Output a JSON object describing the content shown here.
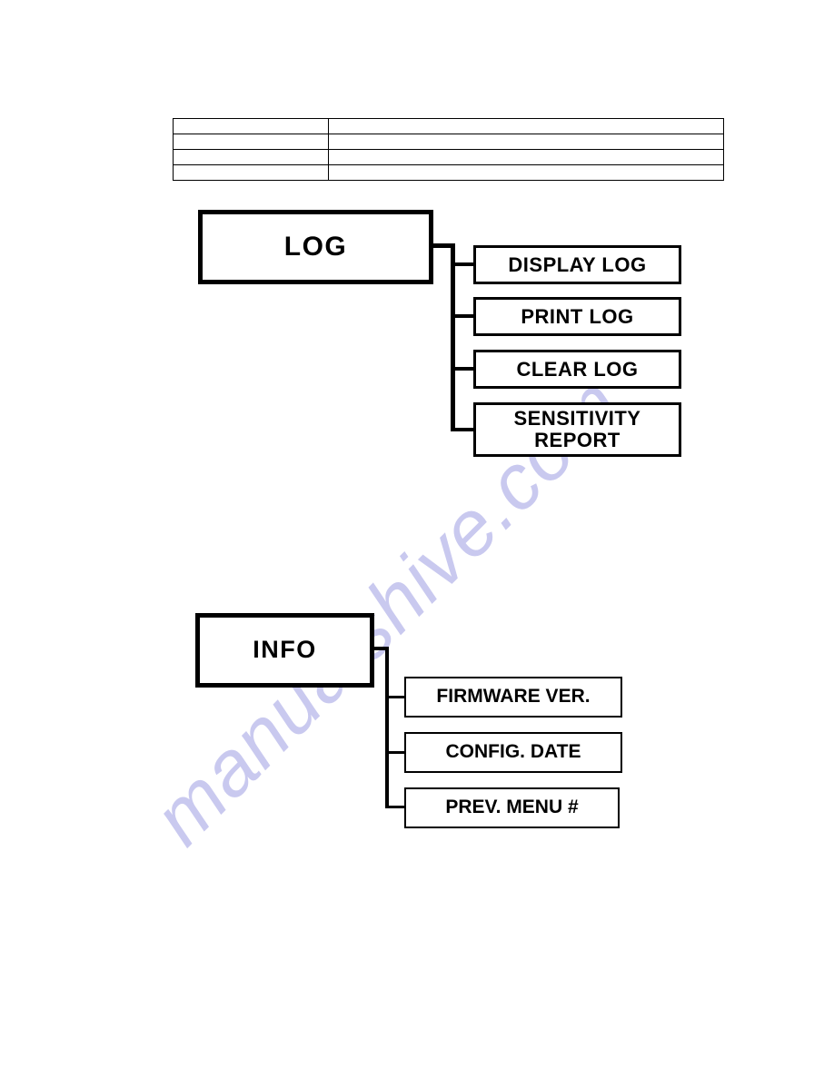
{
  "page": {
    "background": "#ffffff",
    "ink": "#000000",
    "watermark": {
      "text": "manualshive.com",
      "color": "#c9c9ef"
    }
  },
  "spec_table": {
    "columns": [
      "",
      ""
    ],
    "rows": [
      [
        "",
        ""
      ],
      [
        "",
        ""
      ],
      [
        "",
        ""
      ],
      [
        "",
        ""
      ]
    ]
  },
  "diagram": {
    "groups": [
      {
        "id": "log",
        "root": {
          "label": "LOG"
        },
        "children": [
          {
            "label": "DISPLAY LOG"
          },
          {
            "label": "PRINT LOG"
          },
          {
            "label": "CLEAR LOG"
          },
          {
            "label_line1": "SENSITIVITY",
            "label_line2": "REPORT"
          }
        ]
      },
      {
        "id": "info",
        "root": {
          "label": "INFO"
        },
        "children": [
          {
            "label": "FIRMWARE VER."
          },
          {
            "label": "CONFIG. DATE"
          },
          {
            "label": "PREV. MENU #"
          }
        ]
      }
    ]
  }
}
